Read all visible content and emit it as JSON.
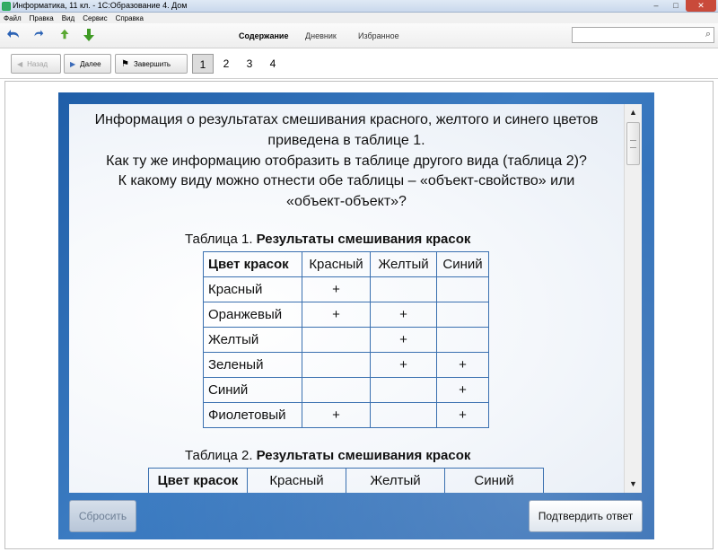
{
  "window": {
    "title": "Информатика, 11 кл. - 1С:Образование 4. Дом",
    "minimize": "–",
    "maximize": "□",
    "close": "✕"
  },
  "menu": {
    "items": [
      "Файл",
      "Правка",
      "Вид",
      "Сервис",
      "Справка"
    ]
  },
  "toolbar": {
    "tabs": [
      "Содержание",
      "Дневник",
      "Избранное"
    ],
    "active_tab": "Содержание",
    "search_value": "",
    "icons": [
      "back-arrow-icon",
      "forward-arrow-icon",
      "up-arrow-icon",
      "down-arrow-icon",
      "search-icon"
    ],
    "icon_colors": {
      "back": "#2c63b5",
      "forward": "#2c63b5",
      "up": "#5aa832",
      "down": "#3f9a25"
    }
  },
  "navigation": {
    "back_label": "Назад",
    "next_label": "Далее",
    "finish_label": "Завершить",
    "pages": [
      "1",
      "2",
      "3",
      "4"
    ],
    "current_page": "1"
  },
  "task": {
    "question": "Информация о результатах смешивания красного, желтого и синего цветов приведена в таблице 1.\nКак ту же информацию отобразить в таблице другого вида (таблица 2)?\nК какому виду можно отнести обе таблицы – «объект-свойство» или «объект-объект»?",
    "question_lines": [
      "Информация о результатах смешивания красного, желтого и синего цветов",
      "приведена в таблице 1.",
      "Как ту же информацию отобразить в таблице другого вида (таблица 2)?",
      "К какому виду можно отнести обе таблицы – «объект-свойство» или",
      "«объект-объект»?"
    ],
    "table1": {
      "caption_prefix": "Таблица 1.",
      "caption_title": "Результаты смешивания красок",
      "header": [
        "Цвет красок",
        "Красный",
        "Желтый",
        "Синий"
      ],
      "rows": [
        [
          "Красный",
          "+",
          "",
          ""
        ],
        [
          "Оранжевый",
          "+",
          "+",
          ""
        ],
        [
          "Желтый",
          "",
          "+",
          ""
        ],
        [
          "Зеленый",
          "",
          "+",
          "+"
        ],
        [
          "Синий",
          "",
          "",
          "+"
        ],
        [
          "Фиолетовый",
          "+",
          "",
          "+"
        ]
      ]
    },
    "table2": {
      "caption_prefix": "Таблица 2.",
      "caption_title": "Результаты смешивания красок",
      "header": [
        "Цвет красок",
        "Красный",
        "Желтый",
        "Синий"
      ]
    }
  },
  "actions": {
    "reset_label": "Сбросить",
    "confirm_label": "Подтвердить ответ"
  },
  "colors": {
    "panel_blue": "#2a66b0",
    "table_border": "#3a70b0"
  }
}
